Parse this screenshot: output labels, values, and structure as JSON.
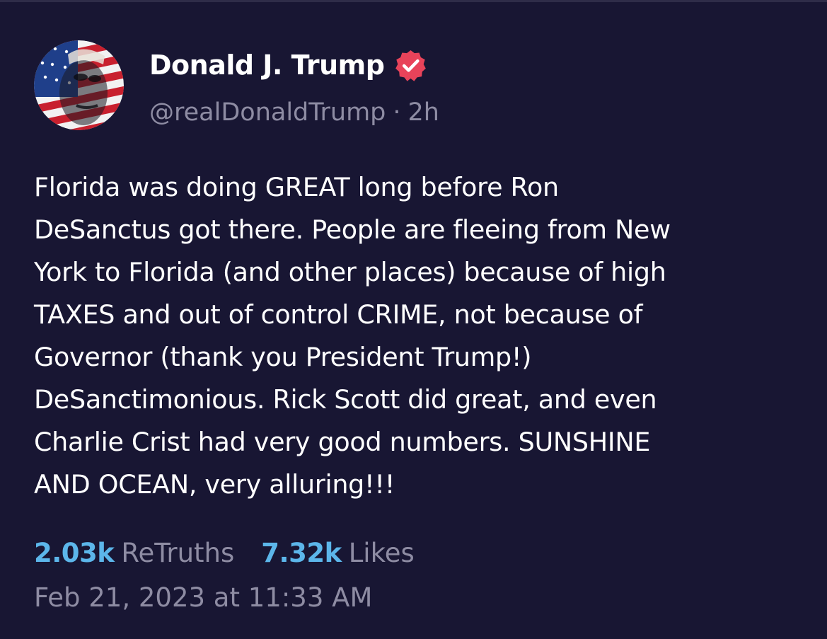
{
  "author": {
    "display_name": "Donald J. Trump",
    "handle": "@realDonaldTrump",
    "separator": "·",
    "relative_time": "2h",
    "verified": true
  },
  "post": {
    "lines": [
      "Florida was doing GREAT long before Ron",
      "DeSanctus got there. People are fleeing from New",
      "York to Florida (and other places) because of high",
      "TAXES and out of control CRIME, not because of",
      "Governor (thank you President Trump!)",
      "DeSanctimonious. Rick Scott did great, and even",
      "Charlie Crist had very good numbers. SUNSHINE",
      "AND OCEAN, very alluring!!!"
    ]
  },
  "stats": {
    "retruths_count": "2.03k",
    "retruths_label": "ReTruths",
    "likes_count": "7.32k",
    "likes_label": "Likes"
  },
  "timestamp": "Feb 21, 2023 at 11:33 AM",
  "colors": {
    "background": "#181633",
    "text": "#ffffff",
    "muted": "#8e8ca3",
    "accent": "#5cb6ea",
    "verified_badge": "#e8435a"
  }
}
